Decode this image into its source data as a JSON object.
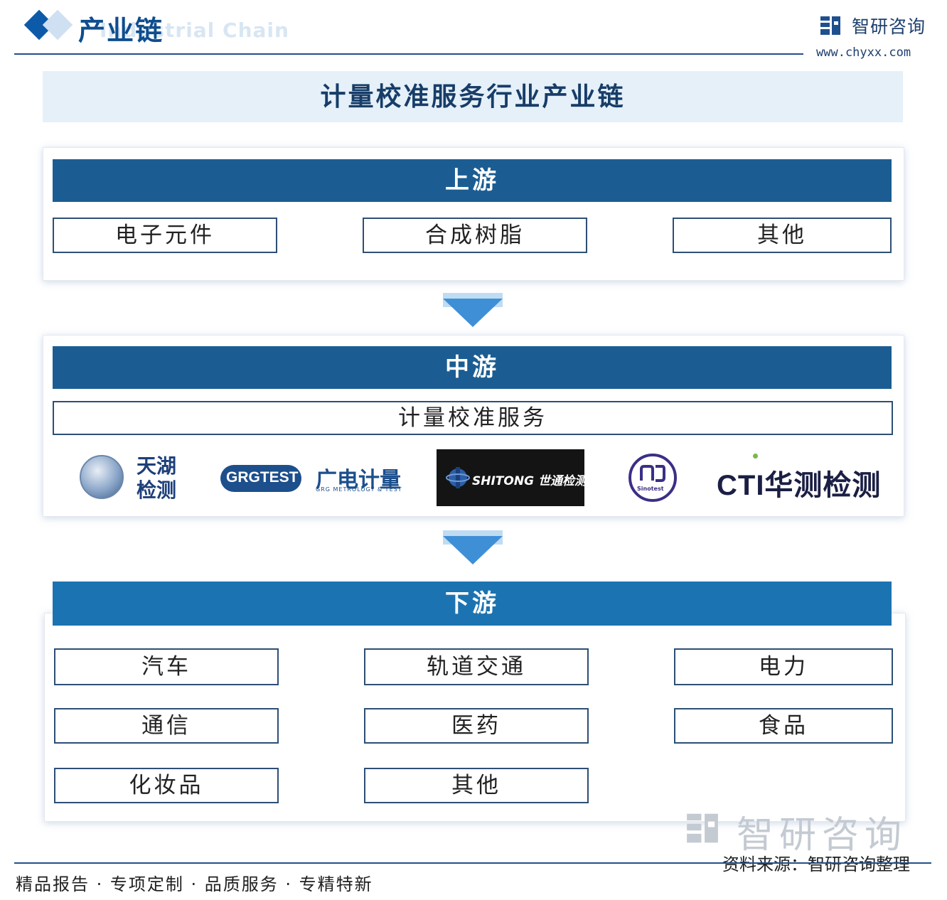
{
  "header": {
    "section_title": "产业链",
    "section_subtitle": "Industrial Chain",
    "brand_name": "智研咨询",
    "brand_url": "www.chyxx.com"
  },
  "title": "计量校准服务行业产业链",
  "upstream": {
    "label": "上游",
    "items": [
      "电子元件",
      "合成树脂",
      "其他"
    ]
  },
  "midstream": {
    "label": "中游",
    "items": [
      "计量校准服务"
    ],
    "logos": [
      {
        "text": "天湖\n检测",
        "line1": "天湖",
        "line2": "检测",
        "icon": "tianhu-globe-logo"
      },
      {
        "text": "GRGTEST",
        "cn": "广电计量",
        "sub": "GRG METROLOGY & TEST"
      },
      {
        "text": "SHITONG 世通检测"
      },
      {
        "text": "Sinotest"
      },
      {
        "text": "CTI华测检测"
      }
    ]
  },
  "downstream": {
    "label": "下游",
    "items": [
      "汽车",
      "轨道交通",
      "电力",
      "通信",
      "医药",
      "食品",
      "化妆品",
      "其他"
    ]
  },
  "footer": {
    "tags": "精品报告 · 专项定制 · 品质服务 · 专精特新",
    "source": "资料来源：智研咨询整理",
    "watermark": "智研咨询"
  },
  "colors": {
    "bar": "#1b5d92",
    "arrow": "#3f8fd6",
    "banner": "#e6f0f9",
    "accent": "#0d5aa8"
  }
}
